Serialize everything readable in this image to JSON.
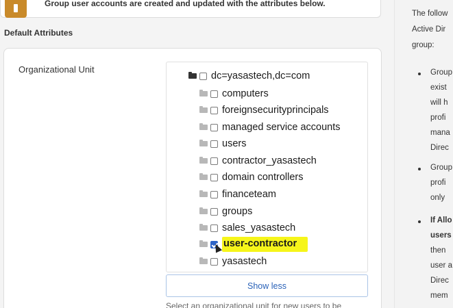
{
  "notice": {
    "text": "Group user accounts are created and updated with the attributes below."
  },
  "section": {
    "heading": "Default Attributes"
  },
  "org_unit": {
    "label": "Organizational Unit",
    "root": "dc=yasastech,dc=com",
    "items": [
      {
        "label": "computers",
        "checked": false
      },
      {
        "label": "foreignsecurityprincipals",
        "checked": false
      },
      {
        "label": "managed service accounts",
        "checked": false
      },
      {
        "label": "users",
        "checked": false
      },
      {
        "label": "contractor_yasastech",
        "checked": false
      },
      {
        "label": "domain controllers",
        "checked": false
      },
      {
        "label": "financeteam",
        "checked": false
      },
      {
        "label": "groups",
        "checked": false
      },
      {
        "label": "sales_yasastech",
        "checked": false
      },
      {
        "label": "user-contractor",
        "checked": true
      },
      {
        "label": "yasastech",
        "checked": false
      }
    ],
    "show_less_label": "Show less",
    "helper_text": "Select an organizational unit for new users to be"
  },
  "right_panel": {
    "lines": [
      "The follow",
      "Active Dir",
      "group:"
    ],
    "bullet1": [
      "Group",
      "exist",
      "will h",
      "profi",
      "mana",
      "Direc"
    ],
    "bullet2": [
      "Group",
      "profi",
      "only"
    ],
    "bullet3_bold": [
      "If Allo",
      "users"
    ],
    "bullet3": [
      "then",
      "user a",
      "Direc",
      "mem"
    ]
  },
  "colors": {
    "accent": "#2a62b8",
    "highlight": "#f6f51a",
    "notice_icon": "#c98a2a"
  }
}
